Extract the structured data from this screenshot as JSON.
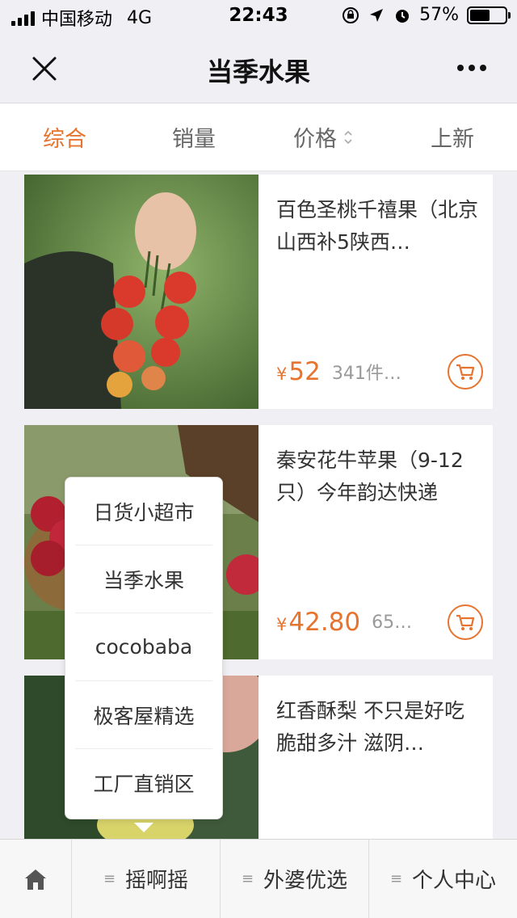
{
  "status_bar": {
    "carrier": "中国移动",
    "network": "4G",
    "time": "22:43",
    "battery": "57%",
    "battery_level": 0.57
  },
  "nav": {
    "title": "当季水果"
  },
  "sort_tabs": [
    {
      "label": "综合",
      "active": true
    },
    {
      "label": "销量",
      "active": false
    },
    {
      "label": "价格",
      "active": false
    },
    {
      "label": "上新",
      "active": false
    }
  ],
  "products": [
    {
      "name": "百色圣桃千禧果（北京山西补5陕西…",
      "currency": "¥",
      "price": "52",
      "sold": "341件…"
    },
    {
      "name": "秦安花牛苹果（9-12只）今年韵达快递",
      "currency": "¥",
      "price": "42.80",
      "sold": "65…"
    },
    {
      "name": "红香酥梨 不只是好吃 脆甜多汁 滋阴…",
      "currency": "¥",
      "price": "",
      "sold": ""
    }
  ],
  "popup_menu": {
    "items": [
      "日货小超市",
      "当季水果",
      "cocobaba",
      "极客屋精选",
      "工厂直销区"
    ]
  },
  "tab_bar": {
    "tabs": [
      {
        "label": "",
        "icon": "home-icon"
      },
      {
        "label": "摇啊摇",
        "icon": "menu-lines-icon"
      },
      {
        "label": "外婆优选",
        "icon": "menu-lines-icon"
      },
      {
        "label": "个人中心",
        "icon": "menu-lines-icon"
      }
    ]
  },
  "colors": {
    "accent": "#e7742e",
    "background": "#efeff4"
  }
}
